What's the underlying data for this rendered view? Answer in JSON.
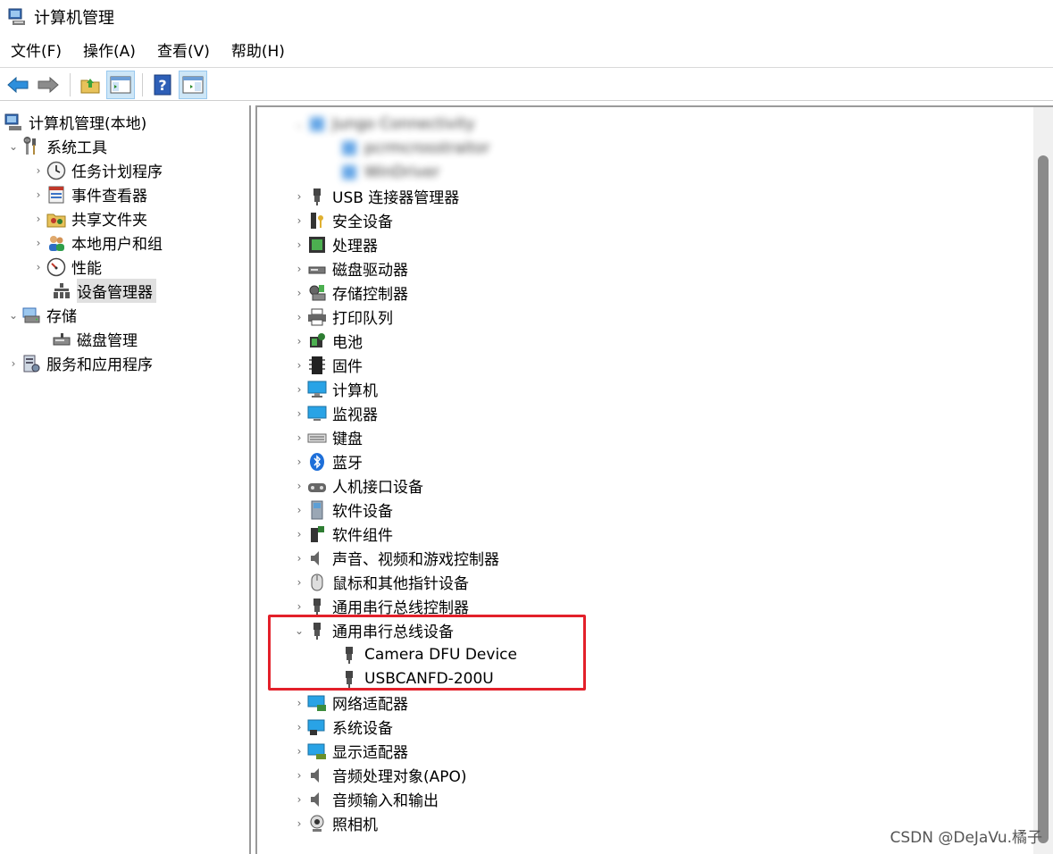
{
  "window": {
    "title": "计算机管理"
  },
  "menu": [
    "文件(F)",
    "操作(A)",
    "查看(V)",
    "帮助(H)"
  ],
  "toolbar": [
    "back-icon",
    "forward-icon",
    "up-folder-icon",
    "show-hide-tree-icon",
    "help-icon",
    "show-hide-action-icon"
  ],
  "tree": {
    "root": "计算机管理(本地)",
    "system_tools": "系统工具",
    "task_scheduler": "任务计划程序",
    "event_viewer": "事件查看器",
    "shared_folders": "共享文件夹",
    "local_users": "本地用户和组",
    "performance": "性能",
    "device_manager": "设备管理器",
    "storage": "存储",
    "disk_management": "磁盘管理",
    "services_apps": "服务和应用程序"
  },
  "devices": {
    "blurred_1": "Jungo Connectivity",
    "blurred_2": "pcrmcrosstraitor",
    "blurred_3": "WinDriver",
    "categories": [
      "USB 连接器管理器",
      "安全设备",
      "处理器",
      "磁盘驱动器",
      "存储控制器",
      "打印队列",
      "电池",
      "固件",
      "计算机",
      "监视器",
      "键盘",
      "蓝牙",
      "人机接口设备",
      "软件设备",
      "软件组件",
      "声音、视频和游戏控制器",
      "鼠标和其他指针设备",
      "通用串行总线控制器",
      "通用串行总线设备",
      "网络适配器",
      "系统设备",
      "显示适配器",
      "音频处理对象(APO)",
      "音频输入和输出",
      "照相机"
    ],
    "usb_children": [
      "Camera DFU Device",
      "USBCANFD-200U"
    ]
  },
  "watermark": "CSDN @DeJaVu.橘子",
  "colors": {
    "highlight": "#e3202a",
    "selection": "#e0e0e0"
  }
}
